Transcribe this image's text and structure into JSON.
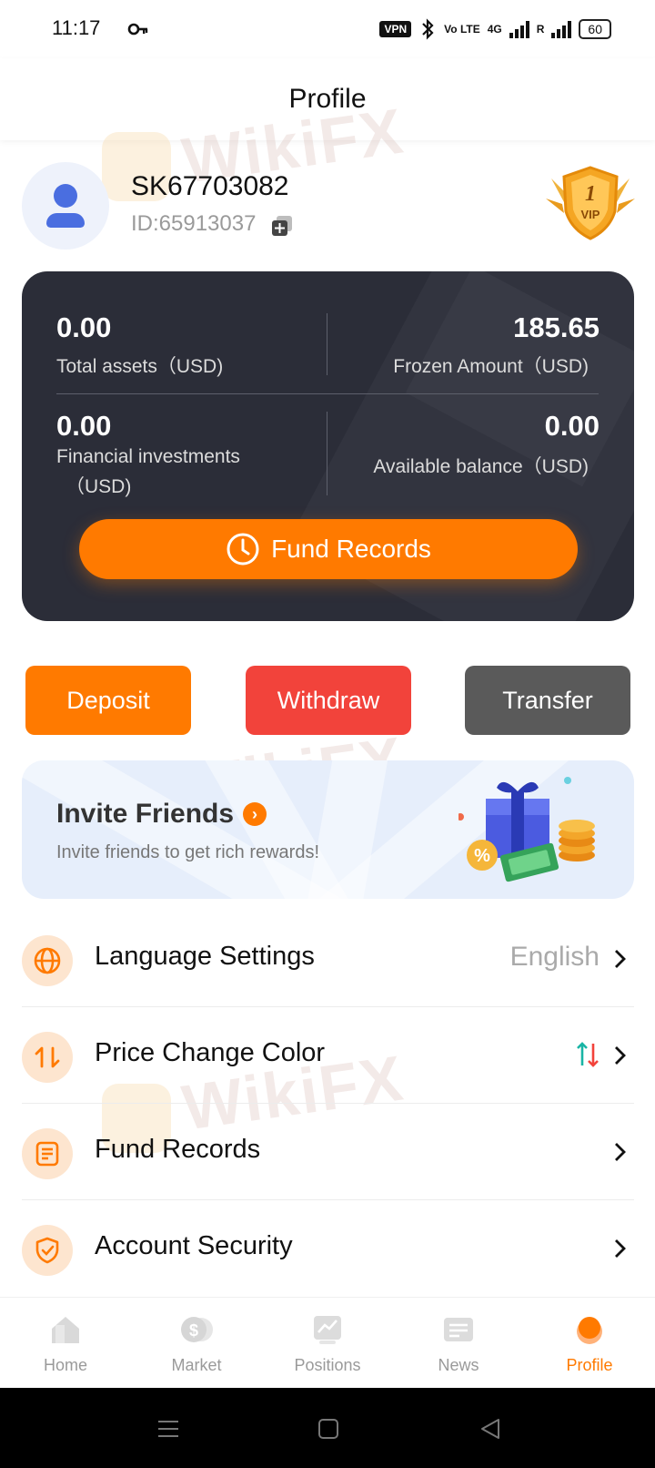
{
  "status_bar": {
    "time": "11:17",
    "vpn": "VPN",
    "volte": "Vo LTE",
    "network": "4G",
    "roaming": "R",
    "battery": "60"
  },
  "header": {
    "title": "Profile"
  },
  "profile": {
    "username": "SK67703082",
    "user_id": "ID:65913037",
    "vip_level": "1",
    "vip_text": "VIP"
  },
  "assets": {
    "total_assets_value": "0.00",
    "total_assets_label": "Total assets（USD)",
    "frozen_value": "185.65",
    "frozen_label": "Frozen Amount（USD)",
    "financial_value": "0.00",
    "financial_label_line1": "Financial investments",
    "financial_label_line2": "（USD)",
    "available_value": "0.00",
    "available_label": "Available balance（USD)",
    "fund_records_button": "Fund Records"
  },
  "actions": {
    "deposit": "Deposit",
    "withdraw": "Withdraw",
    "transfer": "Transfer"
  },
  "invite": {
    "title": "Invite Friends",
    "subtitle": "Invite friends to get rich rewards!"
  },
  "menu": [
    {
      "label": "Language Settings",
      "value": "English",
      "icon": "globe-icon"
    },
    {
      "label": "Price Change Color",
      "value": "",
      "icon": "swap-icon"
    },
    {
      "label": "Fund Records",
      "value": "",
      "icon": "document-icon"
    },
    {
      "label": "Account Security",
      "value": "",
      "icon": "shield-check-icon"
    }
  ],
  "tabs": [
    {
      "label": "Home",
      "icon": "home-icon"
    },
    {
      "label": "Market",
      "icon": "market-icon"
    },
    {
      "label": "Positions",
      "icon": "positions-icon"
    },
    {
      "label": "News",
      "icon": "news-icon"
    },
    {
      "label": "Profile",
      "icon": "profile-icon",
      "active": true
    }
  ],
  "watermark": "WikiFX",
  "colors": {
    "accent": "#ff7a00",
    "danger": "#f2433b",
    "neutral_button": "#5a5a5a",
    "card_dark": "#2b2d38",
    "up_color": "#19b5a5",
    "down_color": "#f2433b"
  }
}
